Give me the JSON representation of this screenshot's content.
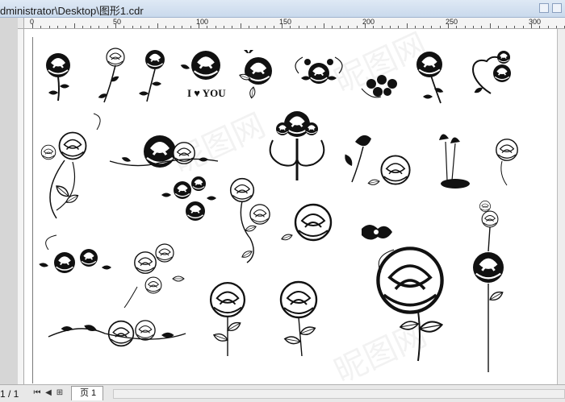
{
  "window": {
    "title": "dministrator\\Desktop\\图形1.cdr"
  },
  "ruler": {
    "labels": [
      "0",
      "50",
      "100",
      "150",
      "200",
      "250",
      "300"
    ]
  },
  "status": {
    "page_count": "1 / 1",
    "page_tab": "页 1"
  },
  "artwork": {
    "watermark": "昵图网",
    "love_text": "I ♥ YOU",
    "items": [
      "rose-small-1",
      "rose-stem-2",
      "rose-stem-3",
      "rose-love",
      "rose-butterfly",
      "rose-swirl",
      "flower-cluster",
      "rose-leaves",
      "rose-heart",
      "rose-tall-branch",
      "rose-horizontal-vine",
      "rose-ornament",
      "rose-bud",
      "rose-open",
      "rose-tulip",
      "rose-outline-small",
      "roses-trio",
      "rose-vine-vertical",
      "rose-outline-medium",
      "hibiscus-small",
      "roses-corner",
      "rose-bouquet-sketch",
      "rose-engraved-1",
      "rose-engraved-2",
      "rose-large-sketch",
      "rose-tall-stem",
      "rose-long-vine"
    ]
  },
  "colors": {
    "titlebar": "#c9d9ec",
    "ruler": "#f4f4f4",
    "canvas": "#ffffff",
    "ink": "#111111"
  }
}
